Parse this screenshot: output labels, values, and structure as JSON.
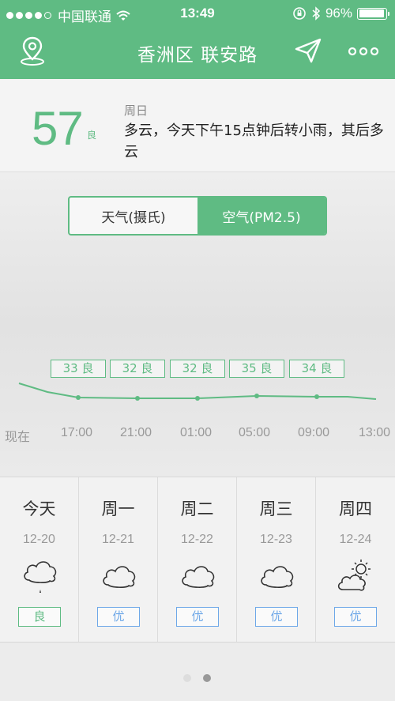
{
  "status_bar": {
    "carrier": "中国联通",
    "time": "13:49",
    "battery": "96%",
    "signal_bars_filled": 4,
    "signal_bars_total": 5,
    "battery_level": 0.96
  },
  "nav": {
    "title": "香洲区 联安路",
    "location_icon": "location-pin-icon",
    "share_icon": "paper-plane-icon",
    "more_icon": "more-dots-icon"
  },
  "summary": {
    "aqi": "57",
    "grade": "良",
    "day": "周日",
    "forecast": "多云，今天下午15点钟后转小雨，其后多云"
  },
  "toggle": {
    "weather_label": "天气(摄氏)",
    "air_label": "空气(PM2.5)",
    "active": "air"
  },
  "chart_data": {
    "type": "line",
    "x": [
      "17:00",
      "21:00",
      "01:00",
      "05:00",
      "09:00"
    ],
    "values": [
      33,
      32,
      32,
      35,
      34
    ],
    "labels": [
      "33 良",
      "32 良",
      "32 良",
      "35 良",
      "34 良"
    ],
    "time_axis": [
      "现在",
      "17:00",
      "21:00",
      "01:00",
      "05:00",
      "09:00",
      "13:00"
    ],
    "color": "#5fbb83"
  },
  "days": [
    {
      "name": "今天",
      "date": "12-20",
      "icon": "cloud-rain-icon",
      "quality": "良"
    },
    {
      "name": "周一",
      "date": "12-21",
      "icon": "cloud-icon",
      "quality": "优"
    },
    {
      "name": "周二",
      "date": "12-22",
      "icon": "cloud-icon",
      "quality": "优"
    },
    {
      "name": "周三",
      "date": "12-23",
      "icon": "cloud-icon",
      "quality": "优"
    },
    {
      "name": "周四",
      "date": "12-24",
      "icon": "partly-sunny-icon",
      "quality": "优"
    }
  ],
  "pager": {
    "count": 2,
    "active": 1
  },
  "colors": {
    "accent": "#5fbb83",
    "excellent": "#6ea8e8"
  }
}
